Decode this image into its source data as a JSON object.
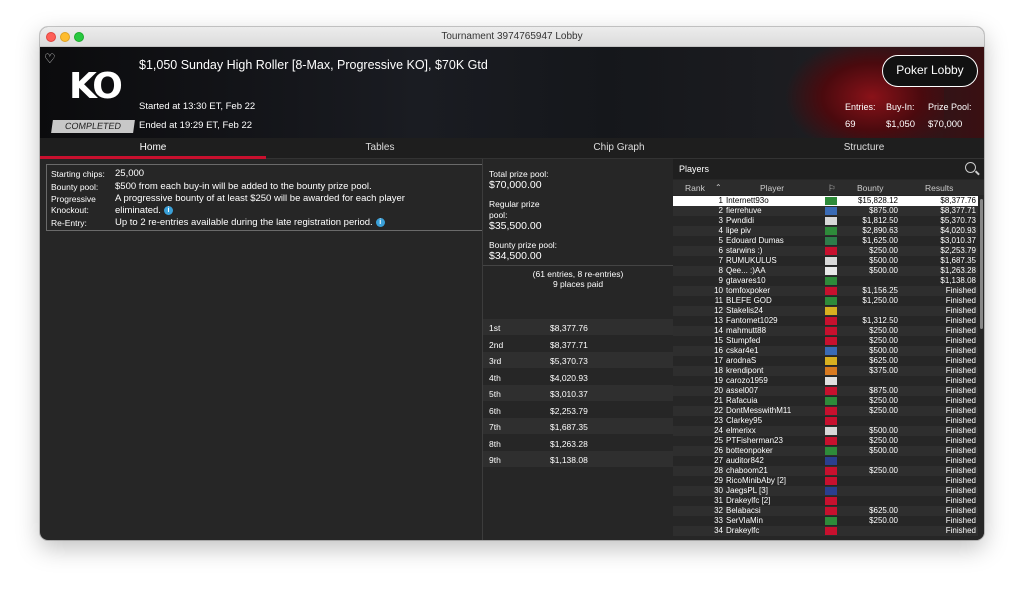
{
  "window": {
    "title": "Tournament 3974765947 Lobby"
  },
  "header": {
    "logo": "KO",
    "status_badge": "COMPLETED",
    "tournament_name": "$1,050 Sunday High Roller [8-Max, Progressive KO], $70K Gtd",
    "started": "Started at 13:30 ET, Feb 22",
    "ended": "Ended at 19:29 ET, Feb 22",
    "lobby_button": "Poker Lobby",
    "stats": [
      {
        "label": "Entries:",
        "value": "69"
      },
      {
        "label": "Buy-In:",
        "value": "$1,050"
      },
      {
        "label": "Prize Pool:",
        "value": "$70,000"
      }
    ]
  },
  "tabs": [
    "Home",
    "Tables",
    "Chip Graph",
    "Structure"
  ],
  "info": {
    "starting_chips_label": "Starting chips:",
    "starting_chips": "25,000",
    "bounty_pool_label": "Bounty pool:",
    "bounty_pool": "$500 from each buy-in will be added to the bounty prize pool.",
    "pko_label_1": "Progressive",
    "pko_label_2": "Knockout:",
    "pko_line1": "A progressive bounty of at least $250 will be awarded for each player",
    "pko_line2": "eliminated.",
    "reentry_label": "Re-Entry:",
    "reentry": "Up to 2 re-entries available during the late registration period."
  },
  "prize": {
    "total_label": "Total prize pool:",
    "total": "$70,000.00",
    "regular_label_1": "Regular prize",
    "regular_label_2": "pool:",
    "regular": "$35,500.00",
    "bounty_label": "Bounty prize pool:",
    "bounty": "$34,500.00",
    "note1": "(61 entries, 8 re-entries)",
    "note2": "9 places paid",
    "places": [
      {
        "place": "1st",
        "amount": "$8,377.76"
      },
      {
        "place": "2nd",
        "amount": "$8,377.71"
      },
      {
        "place": "3rd",
        "amount": "$5,370.73"
      },
      {
        "place": "4th",
        "amount": "$4,020.93"
      },
      {
        "place": "5th",
        "amount": "$3,010.37"
      },
      {
        "place": "6th",
        "amount": "$2,253.79"
      },
      {
        "place": "7th",
        "amount": "$1,687.35"
      },
      {
        "place": "8th",
        "amount": "$1,263.28"
      },
      {
        "place": "9th",
        "amount": "$1,138.08"
      }
    ]
  },
  "players": {
    "title": "Players",
    "columns": [
      "Rank",
      "Player",
      "Bounty",
      "Results"
    ],
    "rows": [
      {
        "rank": "1",
        "name": "Internett93o",
        "flag": "#2e8b3a",
        "bounty": "$15,828.12",
        "result": "$8,377.76"
      },
      {
        "rank": "2",
        "name": "fierrehuve",
        "flag": "#3a6bb5",
        "bounty": "$875.00",
        "result": "$8,377.71"
      },
      {
        "rank": "3",
        "name": "Pwndidi",
        "flag": "#d8d8d8",
        "bounty": "$1,812.50",
        "result": "$5,370.73"
      },
      {
        "rank": "4",
        "name": "lipe piv",
        "flag": "#2e8b3a",
        "bounty": "$2,890.63",
        "result": "$4,020.93"
      },
      {
        "rank": "5",
        "name": "Edouard Dumas",
        "flag": "#2e7d4a",
        "bounty": "$1,625.00",
        "result": "$3,010.37"
      },
      {
        "rank": "6",
        "name": "starwins :)",
        "flag": "#c8102e",
        "bounty": "$250.00",
        "result": "$2,253.79"
      },
      {
        "rank": "7",
        "name": "RUMUKULUS",
        "flag": "#d8d8d8",
        "bounty": "$500.00",
        "result": "$1,687.35"
      },
      {
        "rank": "8",
        "name": "Qee... :)AA",
        "flag": "#e8e8e8",
        "bounty": "$500.00",
        "result": "$1,263.28"
      },
      {
        "rank": "9",
        "name": "gtavares10",
        "flag": "#2e8b3a",
        "bounty": "",
        "result": "$1,138.08"
      },
      {
        "rank": "10",
        "name": "tomfoxpoker",
        "flag": "#c8102e",
        "bounty": "$1,156.25",
        "result": "Finished"
      },
      {
        "rank": "11",
        "name": "BLEFE GOD",
        "flag": "#2e8b3a",
        "bounty": "$1,250.00",
        "result": "Finished"
      },
      {
        "rank": "12",
        "name": "Stakelis24",
        "flag": "#d8b020",
        "bounty": "",
        "result": "Finished"
      },
      {
        "rank": "13",
        "name": "Fantomet1029",
        "flag": "#c8102e",
        "bounty": "$1,312.50",
        "result": "Finished"
      },
      {
        "rank": "14",
        "name": "mahmutt88",
        "flag": "#c8102e",
        "bounty": "$250.00",
        "result": "Finished"
      },
      {
        "rank": "15",
        "name": "Stumpfed",
        "flag": "#c8102e",
        "bounty": "$250.00",
        "result": "Finished"
      },
      {
        "rank": "16",
        "name": "cskar4e1",
        "flag": "#3a6bb5",
        "bounty": "$500.00",
        "result": "Finished"
      },
      {
        "rank": "17",
        "name": "arodnaS",
        "flag": "#d8b020",
        "bounty": "$625.00",
        "result": "Finished"
      },
      {
        "rank": "18",
        "name": "krendipont",
        "flag": "#d87a20",
        "bounty": "$375.00",
        "result": "Finished"
      },
      {
        "rank": "19",
        "name": "carozo1959",
        "flag": "#e0e0e0",
        "bounty": "",
        "result": "Finished"
      },
      {
        "rank": "20",
        "name": "assel007",
        "flag": "#c8102e",
        "bounty": "$875.00",
        "result": "Finished"
      },
      {
        "rank": "21",
        "name": "Rafacuia",
        "flag": "#2e8b3a",
        "bounty": "$250.00",
        "result": "Finished"
      },
      {
        "rank": "22",
        "name": "DontMesswithM11",
        "flag": "#c8102e",
        "bounty": "$250.00",
        "result": "Finished"
      },
      {
        "rank": "23",
        "name": "Clarkey95",
        "flag": "#c8102e",
        "bounty": "",
        "result": "Finished"
      },
      {
        "rank": "24",
        "name": "elmerixx",
        "flag": "#d8d8d8",
        "bounty": "$500.00",
        "result": "Finished"
      },
      {
        "rank": "25",
        "name": "PTFisherman23",
        "flag": "#c8102e",
        "bounty": "$250.00",
        "result": "Finished"
      },
      {
        "rank": "26",
        "name": "botteonpoker",
        "flag": "#2e8b3a",
        "bounty": "$500.00",
        "result": "Finished"
      },
      {
        "rank": "27",
        "name": "auditor842",
        "flag": "#2a3f8f",
        "bounty": "",
        "result": "Finished"
      },
      {
        "rank": "28",
        "name": "chaboom21",
        "flag": "#c8102e",
        "bounty": "$250.00",
        "result": "Finished"
      },
      {
        "rank": "29",
        "name": "RicoMinibAby [2]",
        "flag": "#c8102e",
        "bounty": "",
        "result": "Finished"
      },
      {
        "rank": "30",
        "name": "JaegsPL [3]",
        "flag": "#2a3f8f",
        "bounty": "",
        "result": "Finished"
      },
      {
        "rank": "31",
        "name": "Drakeylfc [2]",
        "flag": "#c8102e",
        "bounty": "",
        "result": "Finished"
      },
      {
        "rank": "32",
        "name": "Belabacsi",
        "flag": "#c8102e",
        "bounty": "$625.00",
        "result": "Finished"
      },
      {
        "rank": "33",
        "name": "SerVlaMin",
        "flag": "#2e8b3a",
        "bounty": "$250.00",
        "result": "Finished"
      },
      {
        "rank": "34",
        "name": "Drakeylfc",
        "flag": "#c8102e",
        "bounty": "",
        "result": "Finished"
      }
    ]
  }
}
